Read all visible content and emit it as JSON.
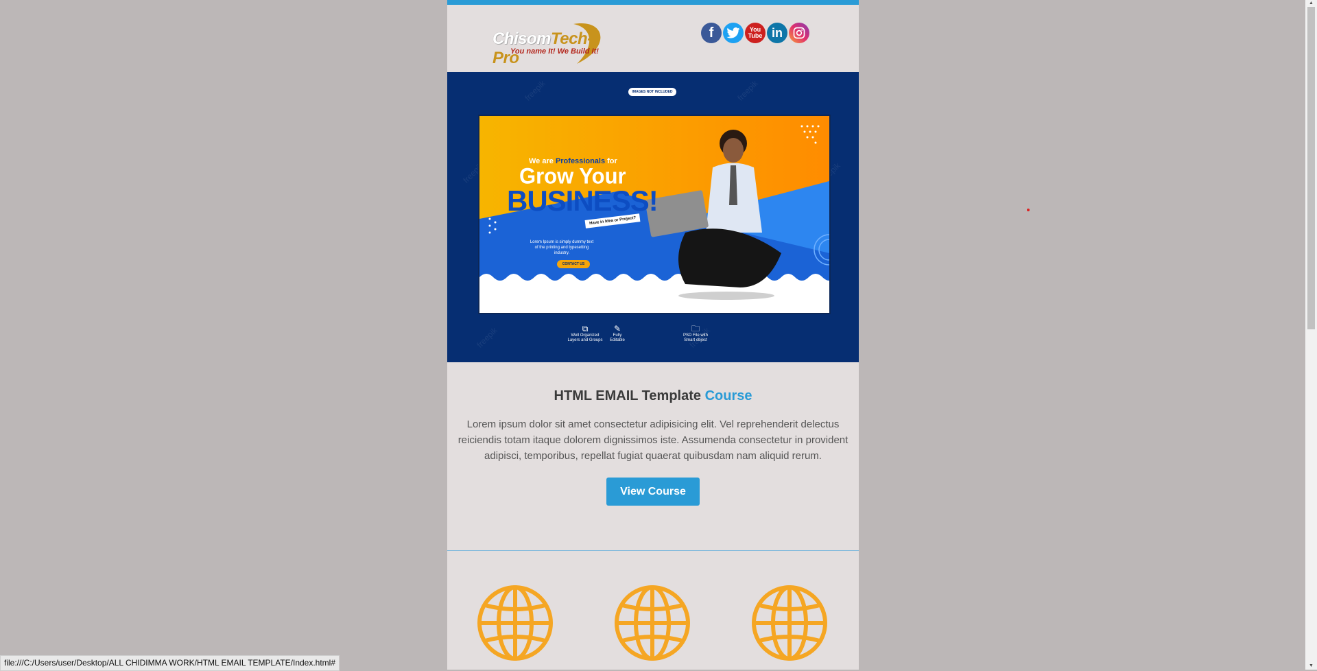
{
  "header": {
    "logo_main_a": "Chisom",
    "logo_main_b": "Tech-Pro",
    "logo_tagline": "You name It! We Build It!",
    "socials": [
      {
        "name": "facebook",
        "glyph": "f"
      },
      {
        "name": "twitter",
        "glyph": "🐦"
      },
      {
        "name": "youtube",
        "glyph": "You Tube"
      },
      {
        "name": "linkedin",
        "glyph": "in"
      },
      {
        "name": "instagram",
        "glyph": "◎"
      }
    ]
  },
  "hero": {
    "badge": "IMAGES NOT INCLUDED",
    "banner": {
      "small_line_a": "We are ",
      "small_line_b": "Professionals",
      "small_line_c": " for",
      "headline_1": "Grow Your",
      "headline_2": "BUSINESS!",
      "note": "Have in Idea or Project?",
      "lorem": "Lorem Ipsum is simply dummy text of the printing and typesetting industry.",
      "cta": "CONTACT US"
    },
    "features": [
      {
        "icon": "layers-icon",
        "glyph": "⧉",
        "label": "Well Organized Layers and Groups"
      },
      {
        "icon": "edit-icon",
        "glyph": "✎",
        "label": "Fully Editable"
      },
      {
        "icon": "folder-icon",
        "glyph": "🗀",
        "label": "PSD File with Smart object"
      }
    ],
    "watermark": "freepik"
  },
  "content": {
    "title_a": "HTML EMAIL Template ",
    "title_b": "Course",
    "paragraph": "Lorem ipsum dolor sit amet consectetur adipisicing elit. Vel reprehenderit delectus reiciendis totam itaque dolorem dignissimos iste. Assumenda consectetur in provident adipisci, temporibus, repellat fugiat quaerat quibusdam nam aliquid rerum.",
    "button": "View Course"
  },
  "status_bar": "file:///C:/Users/user/Desktop/ALL CHIDIMMA WORK/HTML EMAIL TEMPLATE/Index.html#",
  "colors": {
    "page_bg": "#bcb7b7",
    "email_bg": "#e3dede",
    "accent": "#2a9bd6",
    "hero_bg": "#062e72",
    "globe": "#f5a623"
  }
}
